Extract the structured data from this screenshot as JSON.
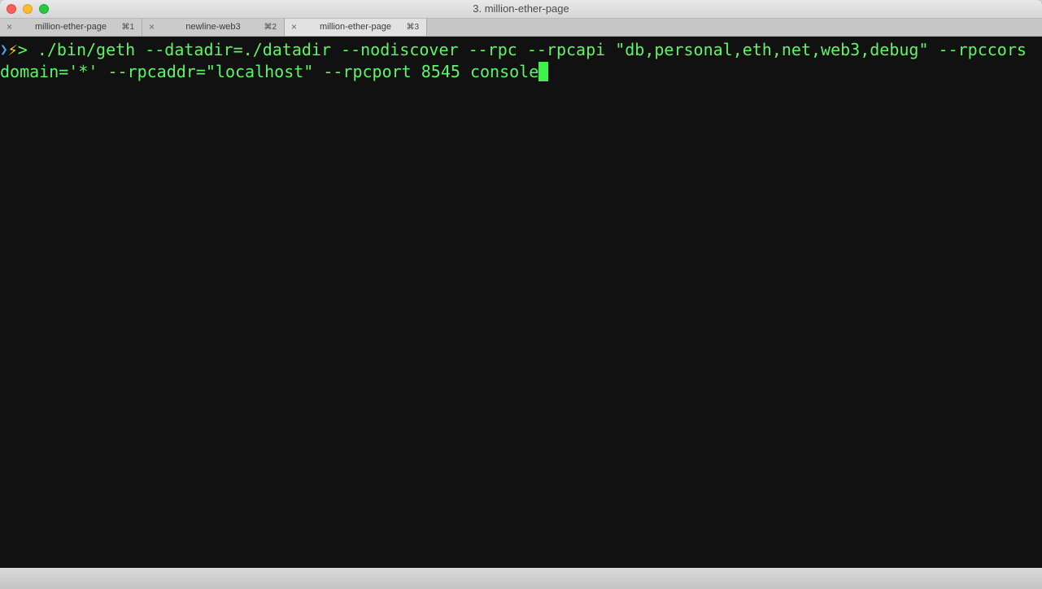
{
  "window": {
    "title": "3. million-ether-page"
  },
  "tabs": [
    {
      "label": "million-ether-page",
      "shortcut": "⌘1",
      "close": "×",
      "active": false
    },
    {
      "label": "newline-web3",
      "shortcut": "⌘2",
      "close": "×",
      "active": false
    },
    {
      "label": "million-ether-page",
      "shortcut": "⌘3",
      "close": "×",
      "active": true
    }
  ],
  "terminal": {
    "prompt_chevron": "❯",
    "prompt_bolt": "⚡",
    "prompt_arrow": ">",
    "line1": " ./bin/geth --datadir=./datadir --nodiscover --rpc --rpcapi \"db,personal,eth,net,web3,debug\" --rpccors",
    "line2": "domain='*' --rpcaddr=\"localhost\" --rpcport 8545 console"
  },
  "colors": {
    "terminal_bg": "#111111",
    "terminal_text": "#5ff467",
    "cursor": "#3ef04a",
    "prompt_bolt": "#ffcc33",
    "prompt_chevron": "#4fa3ff"
  }
}
